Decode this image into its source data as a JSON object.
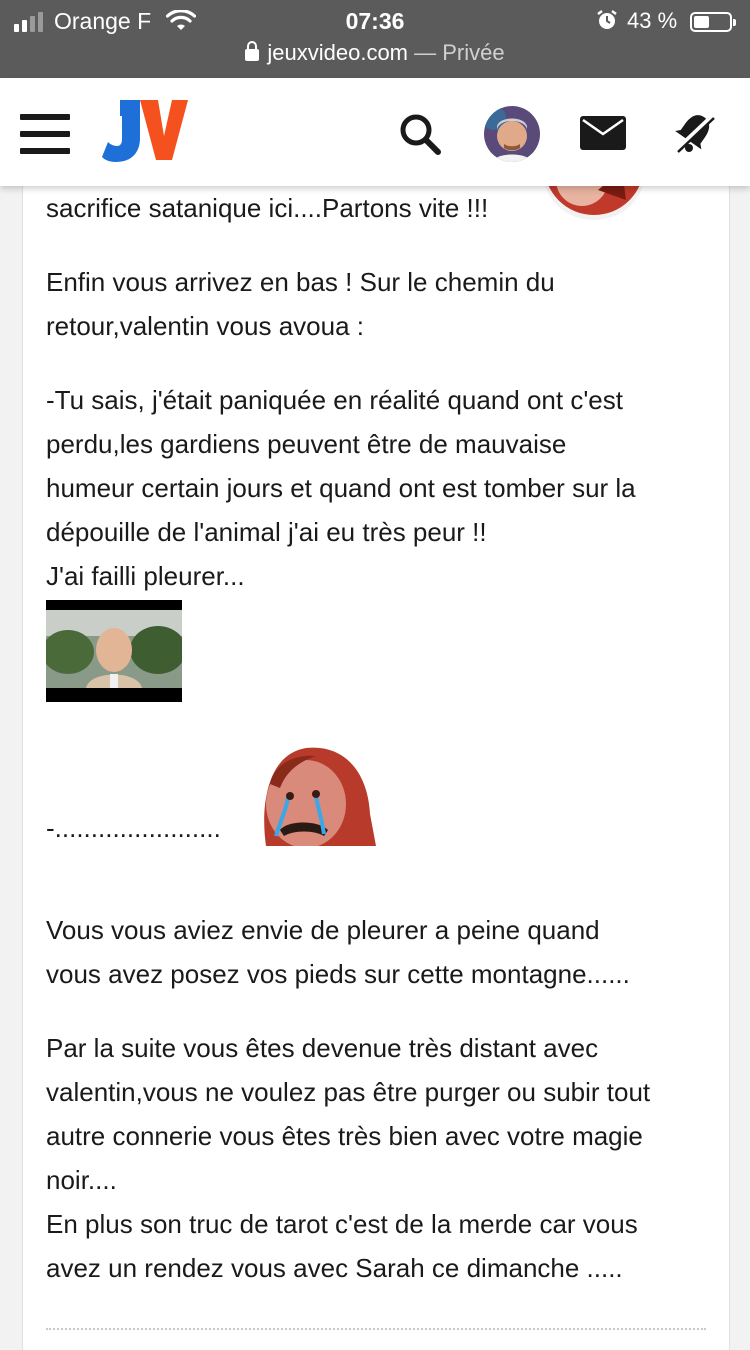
{
  "status_bar": {
    "carrier": "Orange F",
    "time": "07:36",
    "battery": "43 %",
    "battery_level": 0.43,
    "url_domain": "jeuxvideo.com",
    "url_mode": " — Privée"
  },
  "header": {
    "logo_text": "JV",
    "icons": [
      "menu-icon",
      "search-icon",
      "avatar",
      "mail-icon",
      "bell-muted-icon"
    ]
  },
  "post": {
    "p1": "sacrifice satanique ici....Partons vite !!!",
    "p2a": "Enfin vous arrivez en bas ! Sur le chemin du",
    "p2b": "retour,valentin vous avoua :",
    "p3a": "-Tu sais, j'était paniquée en réalité quand ont c'est",
    "p3b": "perdu,les gardiens peuvent être de mauvaise",
    "p3c": "humeur certain jours et quand ont est tomber sur la",
    "p3d": "dépouille de l'animal j'ai eu très peur !!",
    "p3e": "J'ai failli pleurer...",
    "dots": "-.......................",
    "p4a": "Vous vous aviez envie de pleurer a peine quand",
    "p4b": "vous avez posez vos pieds sur cette montagne......",
    "p5a": "Par la suite vous êtes devenue très distant avec",
    "p5b": "valentin,vous ne voulez pas être purger ou subir tout",
    "p5c": "autre connerie vous êtes très bien avec votre magie",
    "p5d": "noir....",
    "p5e": "En plus son truc de tarot c'est de la merde car vous",
    "p5f": "avez un rendez vous avec Sarah ce dimanche ....."
  }
}
